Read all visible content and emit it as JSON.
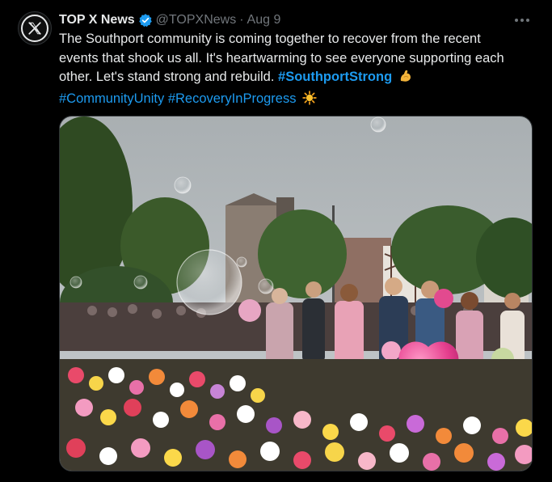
{
  "tweet": {
    "display_name": "TOP X News",
    "handle": "@TOPXNews",
    "separator": "·",
    "date": "Aug 9",
    "text_line1": "The Southport community is coming together to recover from the recent",
    "text_line2": "events that shook us all. It's heartwarming to see everyone supporting each",
    "text_line3": "other. Let's stand strong and rebuild.",
    "hashtag_main": "#SouthportStrong",
    "hashtag_2": "#CommunityUnity",
    "hashtag_3": "#RecoveryInProgress",
    "emoji_1": "flexed-biceps-emoji",
    "emoji_2": "sun-emoji"
  },
  "icons": {
    "avatar": "x-logo-icon",
    "verified": "verified-badge-icon",
    "more": "more-options-icon"
  },
  "colors": {
    "background": "#000000",
    "text": "#e7e9ea",
    "muted": "#71767b",
    "link": "#1d9bf0"
  }
}
